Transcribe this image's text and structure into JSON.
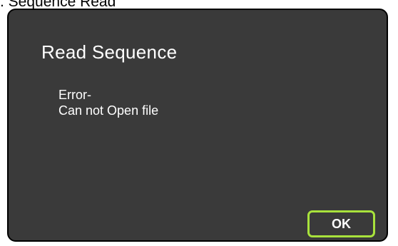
{
  "caption": ". Sequence Read",
  "dialog": {
    "title": "Read Sequence",
    "message_line1": "Error-",
    "message_line2": "Can not Open file",
    "ok_label": "OK"
  },
  "colors": {
    "dialog_background": "#3a3a3a",
    "dialog_border": "#000000",
    "text": "#ffffff",
    "ok_button_border": "#a8e23c"
  }
}
